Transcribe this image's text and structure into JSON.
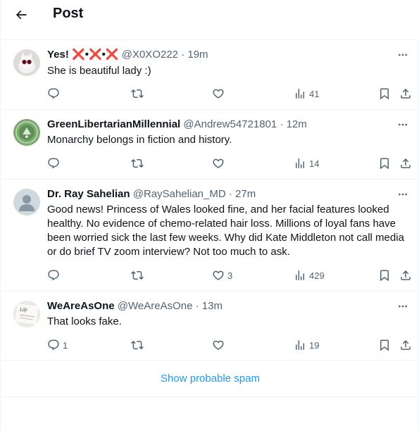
{
  "header": {
    "title": "Post",
    "back_icon": "arrow-left-icon"
  },
  "replies": [
    {
      "name": "Yes! ❌•❌•❌",
      "handle": "@X0XO222",
      "time": "19m",
      "text": "She is beautiful lady :)",
      "reply_count": "",
      "repost_count": "",
      "like_count": "",
      "views": "41"
    },
    {
      "name": "GreenLibertarianMillennial",
      "handle": "@Andrew54721801",
      "time": "12m",
      "text": "Monarchy belongs in fiction and history.",
      "reply_count": "",
      "repost_count": "",
      "like_count": "",
      "views": "14"
    },
    {
      "name": "Dr. Ray Sahelian",
      "handle": "@RaySahelian_MD",
      "time": "27m",
      "text": "Good news! Princess of Wales looked fine, and her facial features looked healthy. No evidence of chemo-related hair loss. Millions of loyal fans have been worried sick the last few weeks. Why did Kate Middleton not call media or do brief TV zoom interview? Not too much to ask.",
      "reply_count": "",
      "repost_count": "",
      "like_count": "3",
      "views": "429"
    },
    {
      "name": "WeAreAsOne",
      "handle": "@WeAreAsOne",
      "time": "13m",
      "text": "That looks fake.",
      "reply_count": "1",
      "repost_count": "",
      "like_count": "",
      "views": "19"
    }
  ],
  "spam": {
    "label": "Show probable spam"
  },
  "colors": {
    "accent": "#1d9bf0",
    "muted": "#536471",
    "text": "#0f1419",
    "border": "#eff3f4"
  }
}
